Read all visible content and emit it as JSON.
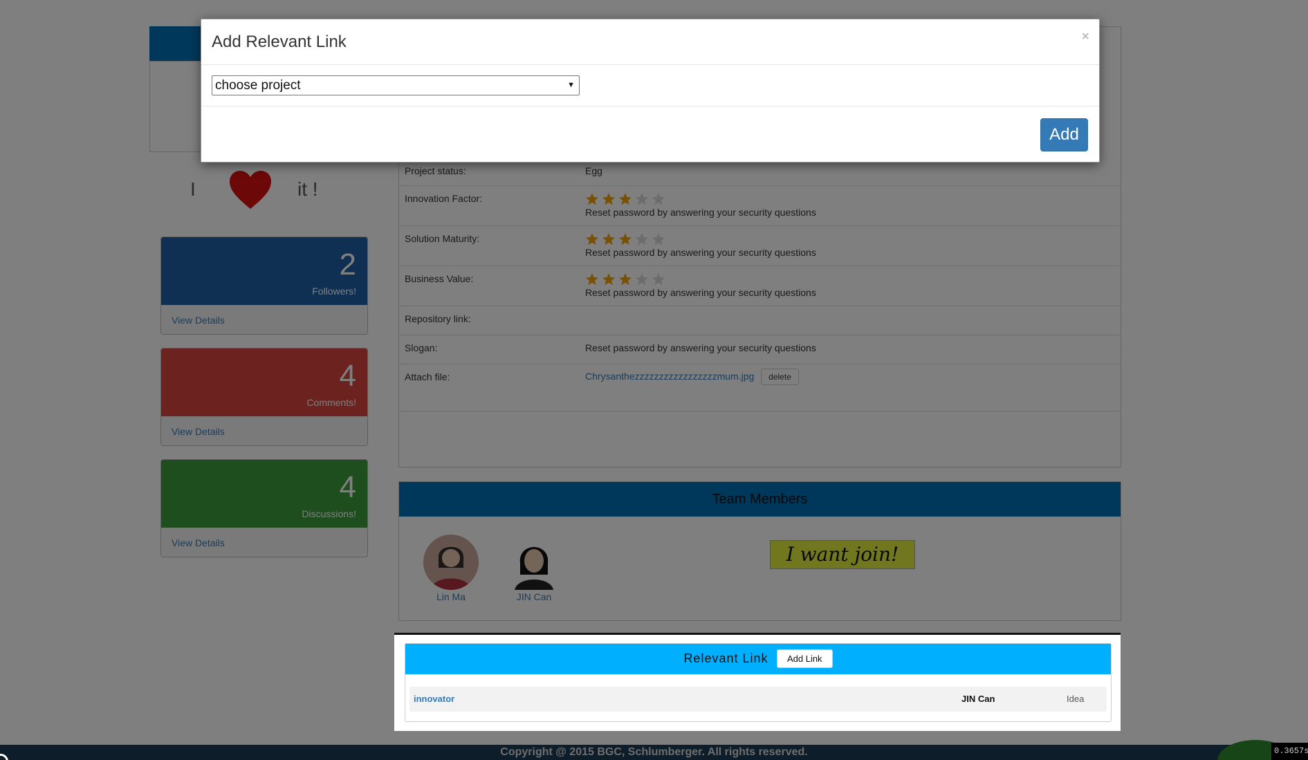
{
  "love": {
    "word_left": "I",
    "word_right": "it !"
  },
  "stats": [
    {
      "count": "2",
      "caption": "Followers!",
      "link": "View Details",
      "color": "#1f5fa6"
    },
    {
      "count": "4",
      "caption": "Comments!",
      "link": "View Details",
      "color": "#d9443f"
    },
    {
      "count": "4",
      "caption": "Discussions!",
      "link": "View Details",
      "color": "#3c9a3c"
    }
  ],
  "info": {
    "project_status": {
      "label": "Project status:",
      "value": "Egg"
    },
    "innovation": {
      "label": "Innovation Factor:",
      "rating": 3,
      "max": 5,
      "text": "Reset password by answering your security questions"
    },
    "maturity": {
      "label": "Solution Maturity:",
      "rating": 3,
      "max": 5,
      "text": "Reset password by answering your security questions"
    },
    "business": {
      "label": "Business Value:",
      "rating": 3,
      "max": 5,
      "text": "Reset password by answering your security questions"
    },
    "repository": {
      "label": "Repository link:"
    },
    "slogan": {
      "label": "Slogan:",
      "value": "Reset password by answering your security questions"
    },
    "attach": {
      "label": "Attach file:",
      "file": "Chrysanthezzzzzzzzzzzzzzzzzmum.jpg",
      "delete_label": "delete"
    }
  },
  "team": {
    "title": "Team Members",
    "members": [
      {
        "name": "Lin Ma"
      },
      {
        "name": "JIN Can"
      }
    ],
    "join_label": "I want join!"
  },
  "relevant": {
    "title": "Relevant Link",
    "add_label": "Add Link",
    "rows": [
      {
        "name": "innovator",
        "user": "JIN Can",
        "type": "Idea"
      }
    ]
  },
  "footer": {
    "text": "Copyright @ 2015 BGC, Schlumberger. All rights reserved."
  },
  "timer": "0.3657s",
  "modal": {
    "title": "Add Relevant Link",
    "close": "×",
    "select_value": "choose project",
    "add_label": "Add"
  },
  "colors": {
    "primary": "#337ab7",
    "header_blue": "#0070b8",
    "link_header": "#00b0ff",
    "star": "#f0a30a"
  }
}
